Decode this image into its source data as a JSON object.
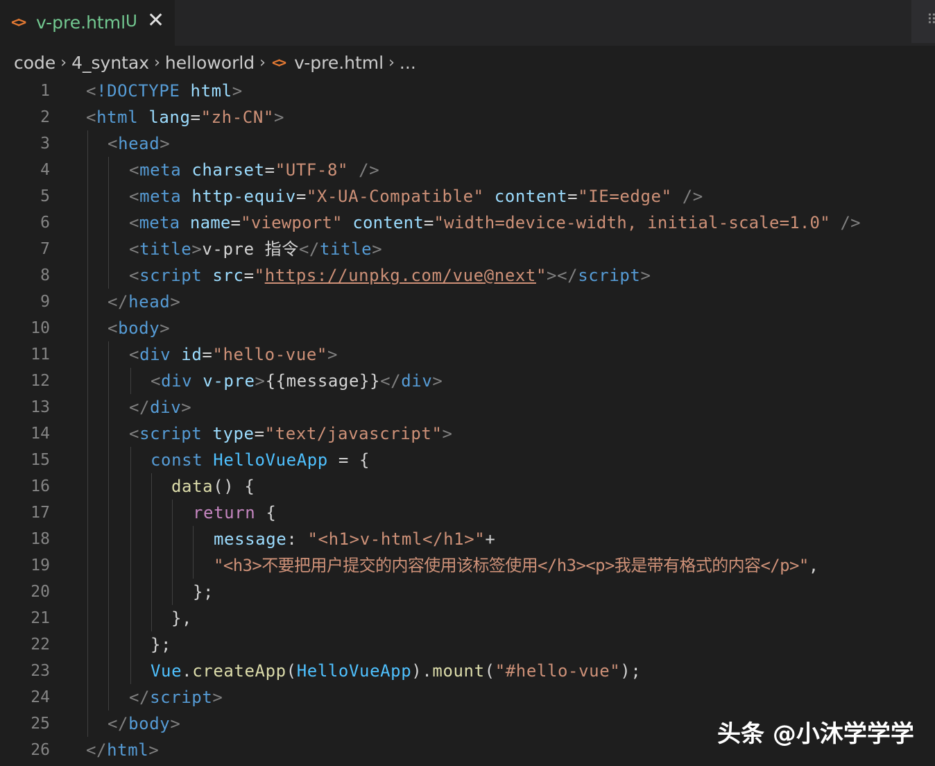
{
  "tab": {
    "icon": "html-file-icon",
    "filename": "v-pre.html",
    "status": "U",
    "close_glyph": "✕",
    "actions_glyph": "⠿"
  },
  "breadcrumb": {
    "items": [
      "code",
      "4_syntax",
      "helloworld",
      "v-pre.html",
      "..."
    ],
    "separator": "›",
    "file_icon_glyph": "<>"
  },
  "editor": {
    "line_numbers": [
      "1",
      "2",
      "3",
      "4",
      "5",
      "6",
      "7",
      "8",
      "9",
      "10",
      "11",
      "12",
      "13",
      "14",
      "15",
      "16",
      "17",
      "18",
      "19",
      "20",
      "21",
      "22",
      "23",
      "24",
      "25",
      "26"
    ],
    "tokens": {
      "l1": [
        "<",
        "!DOCTYPE",
        " html",
        ">"
      ],
      "l2": [
        "<",
        "html",
        " lang",
        "=",
        "\"zh-CN\"",
        ">"
      ],
      "l3": [
        "<",
        "head",
        ">"
      ],
      "l4": [
        "<",
        "meta",
        " charset",
        "=",
        "\"UTF-8\"",
        " />"
      ],
      "l5": [
        "<",
        "meta",
        " http-equiv",
        "=",
        "\"X-UA-Compatible\"",
        " content",
        "=",
        "\"IE=edge\"",
        " />"
      ],
      "l6": [
        "<",
        "meta",
        " name",
        "=",
        "\"viewport\"",
        " content",
        "=",
        "\"width=device-width, initial-scale=1.0\"",
        " />"
      ],
      "l7": [
        "<",
        "title",
        ">",
        "v-pre 指令",
        "</",
        "title",
        ">"
      ],
      "l8": [
        "<",
        "script",
        " src",
        "=",
        "\"",
        "https://unpkg.com/vue@next",
        "\"",
        "></",
        "script",
        ">"
      ],
      "l9": [
        "</",
        "head",
        ">"
      ],
      "l10": [
        "<",
        "body",
        ">"
      ],
      "l11": [
        "<",
        "div",
        " id",
        "=",
        "\"hello-vue\"",
        ">"
      ],
      "l12": [
        "<",
        "div",
        " v-pre",
        ">",
        "{{message}}",
        "</",
        "div",
        ">"
      ],
      "l13": [
        "</",
        "div",
        ">"
      ],
      "l14": [
        "<",
        "script",
        " type",
        "=",
        "\"text/javascript\"",
        ">"
      ],
      "l15": [
        "const",
        " HelloVueApp",
        " = {"
      ],
      "l16": [
        "data",
        "() {"
      ],
      "l17": [
        "return",
        " {"
      ],
      "l18": [
        "message",
        ": ",
        "\"<h1>v-html</h1>\"",
        "+"
      ],
      "l19": [
        "\"<h3>不要把用户提交的内容使用该标签使用</h3><p>我是带有格式的内容</p>\"",
        ","
      ],
      "l20": [
        "};"
      ],
      "l21": [
        "},"
      ],
      "l22": [
        "};"
      ],
      "l23": [
        "Vue",
        ".",
        "createApp",
        "(",
        "HelloVueApp",
        ").",
        "mount",
        "(",
        "\"#hello-vue\"",
        ");"
      ],
      "l24": [
        "</",
        "script",
        ">"
      ],
      "l25": [
        "</",
        "body",
        ">"
      ],
      "l26": [
        "</",
        "html",
        ">"
      ]
    }
  },
  "watermark": "头条 @小沐学学学",
  "colors": {
    "background": "#1e1e1e",
    "tag": "#569cd6",
    "attribute": "#9cdcfe",
    "string": "#ce9178",
    "punctuation": "#808080",
    "keyword_control": "#c586c0",
    "function": "#dcdcaa",
    "class": "#4ec9b0",
    "untracked": "#73c991",
    "html_icon": "#e37933"
  }
}
